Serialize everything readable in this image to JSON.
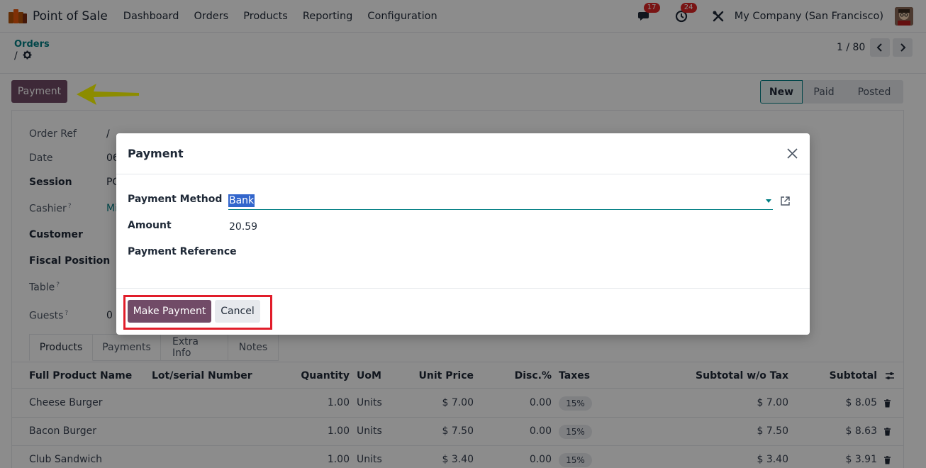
{
  "navbar": {
    "app_title": "Point of Sale",
    "menu": [
      "Dashboard",
      "Orders",
      "Products",
      "Reporting",
      "Configuration"
    ],
    "messages_count": "17",
    "activities_count": "24",
    "company": "My Company (San Francisco)"
  },
  "breadcrumb": {
    "parent": "Orders",
    "current": "/"
  },
  "pager": {
    "value": "1 / 80"
  },
  "actions": {
    "payment_label": "Payment"
  },
  "status": {
    "steps": [
      "New",
      "Paid",
      "Posted"
    ],
    "current": "New"
  },
  "form": {
    "fields": [
      {
        "label": "Order Ref",
        "value": "/",
        "bold": false,
        "help": false
      },
      {
        "label": "Date",
        "value": "06",
        "bold": false,
        "help": false
      },
      {
        "label": "Session",
        "value": "PO",
        "bold": true,
        "help": false
      },
      {
        "label": "Cashier",
        "value": "Mi",
        "bold": false,
        "help": true
      },
      {
        "label": "Customer",
        "value": "",
        "bold": true,
        "help": false
      },
      {
        "label": "Fiscal Position",
        "value": "",
        "bold": true,
        "help": false
      },
      {
        "label": "Table",
        "value": "",
        "bold": false,
        "help": true
      },
      {
        "label": "Guests",
        "value": "0",
        "bold": false,
        "help": true
      }
    ],
    "help_mark": "?"
  },
  "tabs": [
    "Products",
    "Payments",
    "Extra Info",
    "Notes"
  ],
  "table": {
    "headers": {
      "name": "Full Product Name",
      "lot": "Lot/serial Number",
      "qty": "Quantity",
      "uom": "UoM",
      "price": "Unit Price",
      "disc": "Disc.%",
      "taxes": "Taxes",
      "subtotal_wo": "Subtotal w/o Tax",
      "subtotal": "Subtotal"
    },
    "rows": [
      {
        "name": "Cheese Burger",
        "qty": "1.00",
        "uom": "Units",
        "price": "$ 7.00",
        "disc": "0.00",
        "tax": "15%",
        "subtotal_wo": "$ 7.00",
        "subtotal": "$ 8.05"
      },
      {
        "name": "Bacon Burger",
        "qty": "1.00",
        "uom": "Units",
        "price": "$ 7.50",
        "disc": "0.00",
        "tax": "15%",
        "subtotal_wo": "$ 7.50",
        "subtotal": "$ 8.63"
      },
      {
        "name": "Club Sandwich",
        "qty": "1.00",
        "uom": "Units",
        "price": "$ 3.40",
        "disc": "0.00",
        "tax": "15%",
        "subtotal_wo": "$ 3.40",
        "subtotal": "$ 3.91"
      }
    ]
  },
  "dialog": {
    "title": "Payment",
    "payment_method_label": "Payment Method",
    "payment_method_value": "Bank",
    "amount_label": "Amount",
    "amount_value": "20.59",
    "reference_label": "Payment Reference",
    "make_payment_label": "Make Payment",
    "cancel_label": "Cancel"
  },
  "colors": {
    "primary": "#714b67",
    "teal": "#017e84",
    "highlight_red": "#e11d2a",
    "arrow_yellow": "#ffff00"
  }
}
